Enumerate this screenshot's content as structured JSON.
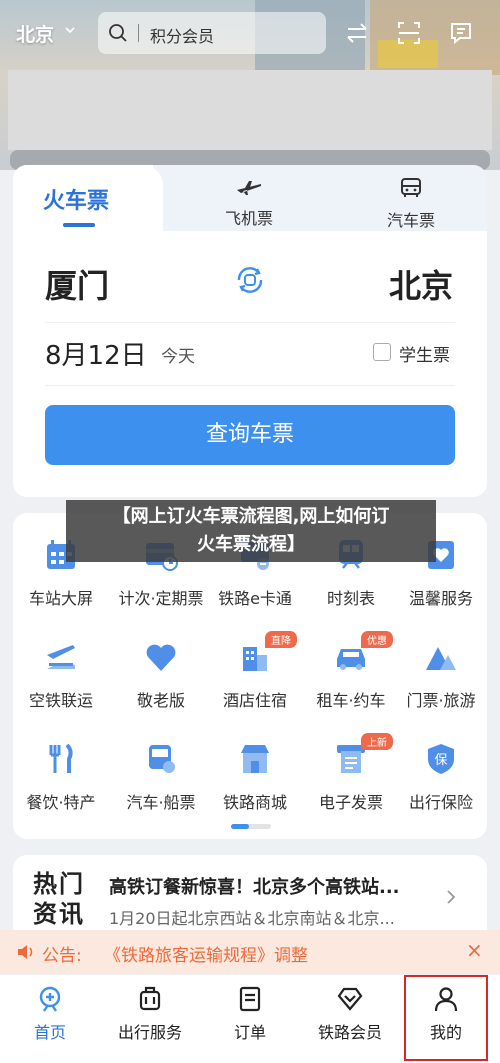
{
  "header": {
    "city": "北京",
    "search_placeholder": "积分会员"
  },
  "booking": {
    "tabs": [
      {
        "label": "火车票",
        "active": true
      },
      {
        "label": "飞机票",
        "active": false
      },
      {
        "label": "汽车票",
        "active": false
      }
    ],
    "from_city": "厦门",
    "to_city": "北京",
    "date": "8月12日",
    "date_hint": "今天",
    "student_label": "学生票",
    "student_checked": false,
    "query_button": "查询车票"
  },
  "services": [
    {
      "label": "车站大屏",
      "icon": "station-screen-icon"
    },
    {
      "label": "计次·定期票",
      "icon": "periodic-ticket-icon"
    },
    {
      "label": "铁路e卡通",
      "icon": "e-card-icon"
    },
    {
      "label": "时刻表",
      "icon": "timetable-icon"
    },
    {
      "label": "温馨服务",
      "icon": "care-service-icon"
    },
    {
      "label": "空铁联运",
      "icon": "air-rail-icon"
    },
    {
      "label": "敬老版",
      "icon": "heart-icon"
    },
    {
      "label": "酒店住宿",
      "icon": "hotel-icon",
      "badge": "直降"
    },
    {
      "label": "租车·约车",
      "icon": "car-icon",
      "badge": "优惠"
    },
    {
      "label": "门票·旅游",
      "icon": "mountain-icon"
    },
    {
      "label": "餐饮·特产",
      "icon": "cutlery-icon"
    },
    {
      "label": "汽车·船票",
      "icon": "bus-icon"
    },
    {
      "label": "铁路商城",
      "icon": "shop-icon"
    },
    {
      "label": "电子发票",
      "icon": "invoice-icon",
      "badge": "上新"
    },
    {
      "label": "出行保险",
      "icon": "insurance-icon"
    }
  ],
  "overlay_title": "【网上订火车票流程图,网上如何订火车票流程】",
  "news": {
    "tag": "热门资讯",
    "title": "高铁订餐新惊喜！北京多个高铁站...",
    "subtitle": "1月20日起北京西站＆北京南站＆北京..."
  },
  "notice": {
    "prefix": "公告:",
    "text": "《铁路旅客运输规程》调整"
  },
  "bottom_nav": [
    {
      "label": "首页",
      "active": true
    },
    {
      "label": "出行服务",
      "active": false
    },
    {
      "label": "订单",
      "active": false
    },
    {
      "label": "铁路会员",
      "active": false
    },
    {
      "label": "我的",
      "active": false
    }
  ],
  "colors": {
    "accent": "#3e90ef",
    "accent_dark": "#2b73d9",
    "notice": "#ef6a3b",
    "badge": "#ee6a4c",
    "highlight_box": "#d62828"
  }
}
